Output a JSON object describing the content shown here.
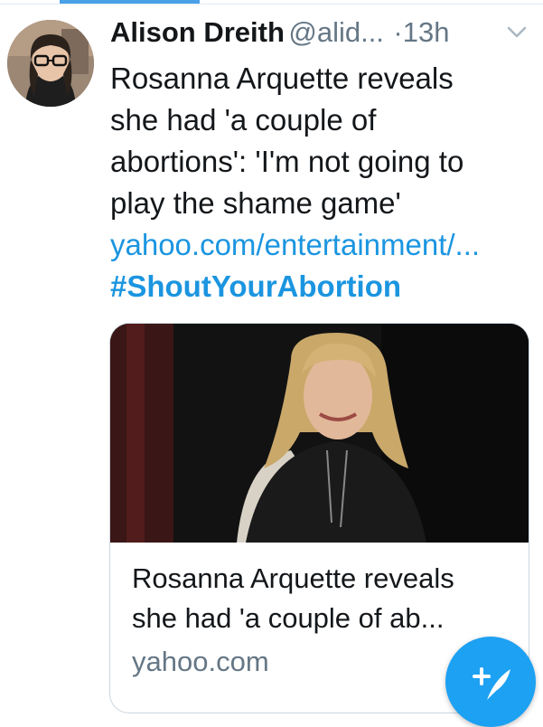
{
  "tweet": {
    "author_name": "Alison Dreith",
    "handle": "@alid...",
    "separator": "·",
    "timestamp": "13h",
    "text_lines": [
      "Rosanna Arquette reveals",
      "she had 'a couple of",
      "abortions': 'I'm not going to",
      "play the shame game'"
    ],
    "link": "yahoo.com/entertainment/...",
    "hashtag": "#ShoutYourAbortion"
  },
  "card": {
    "title_lines": [
      "Rosanna Arquette reveals",
      "she had 'a couple of ab..."
    ],
    "domain": "yahoo.com"
  },
  "icons": {
    "menu": "chevron-down-icon",
    "compose": "compose-tweet-icon"
  },
  "colors": {
    "accent": "#1da1f2",
    "link": "#1b95e0",
    "secondary_text": "#657786",
    "primary_text": "#14171a"
  }
}
